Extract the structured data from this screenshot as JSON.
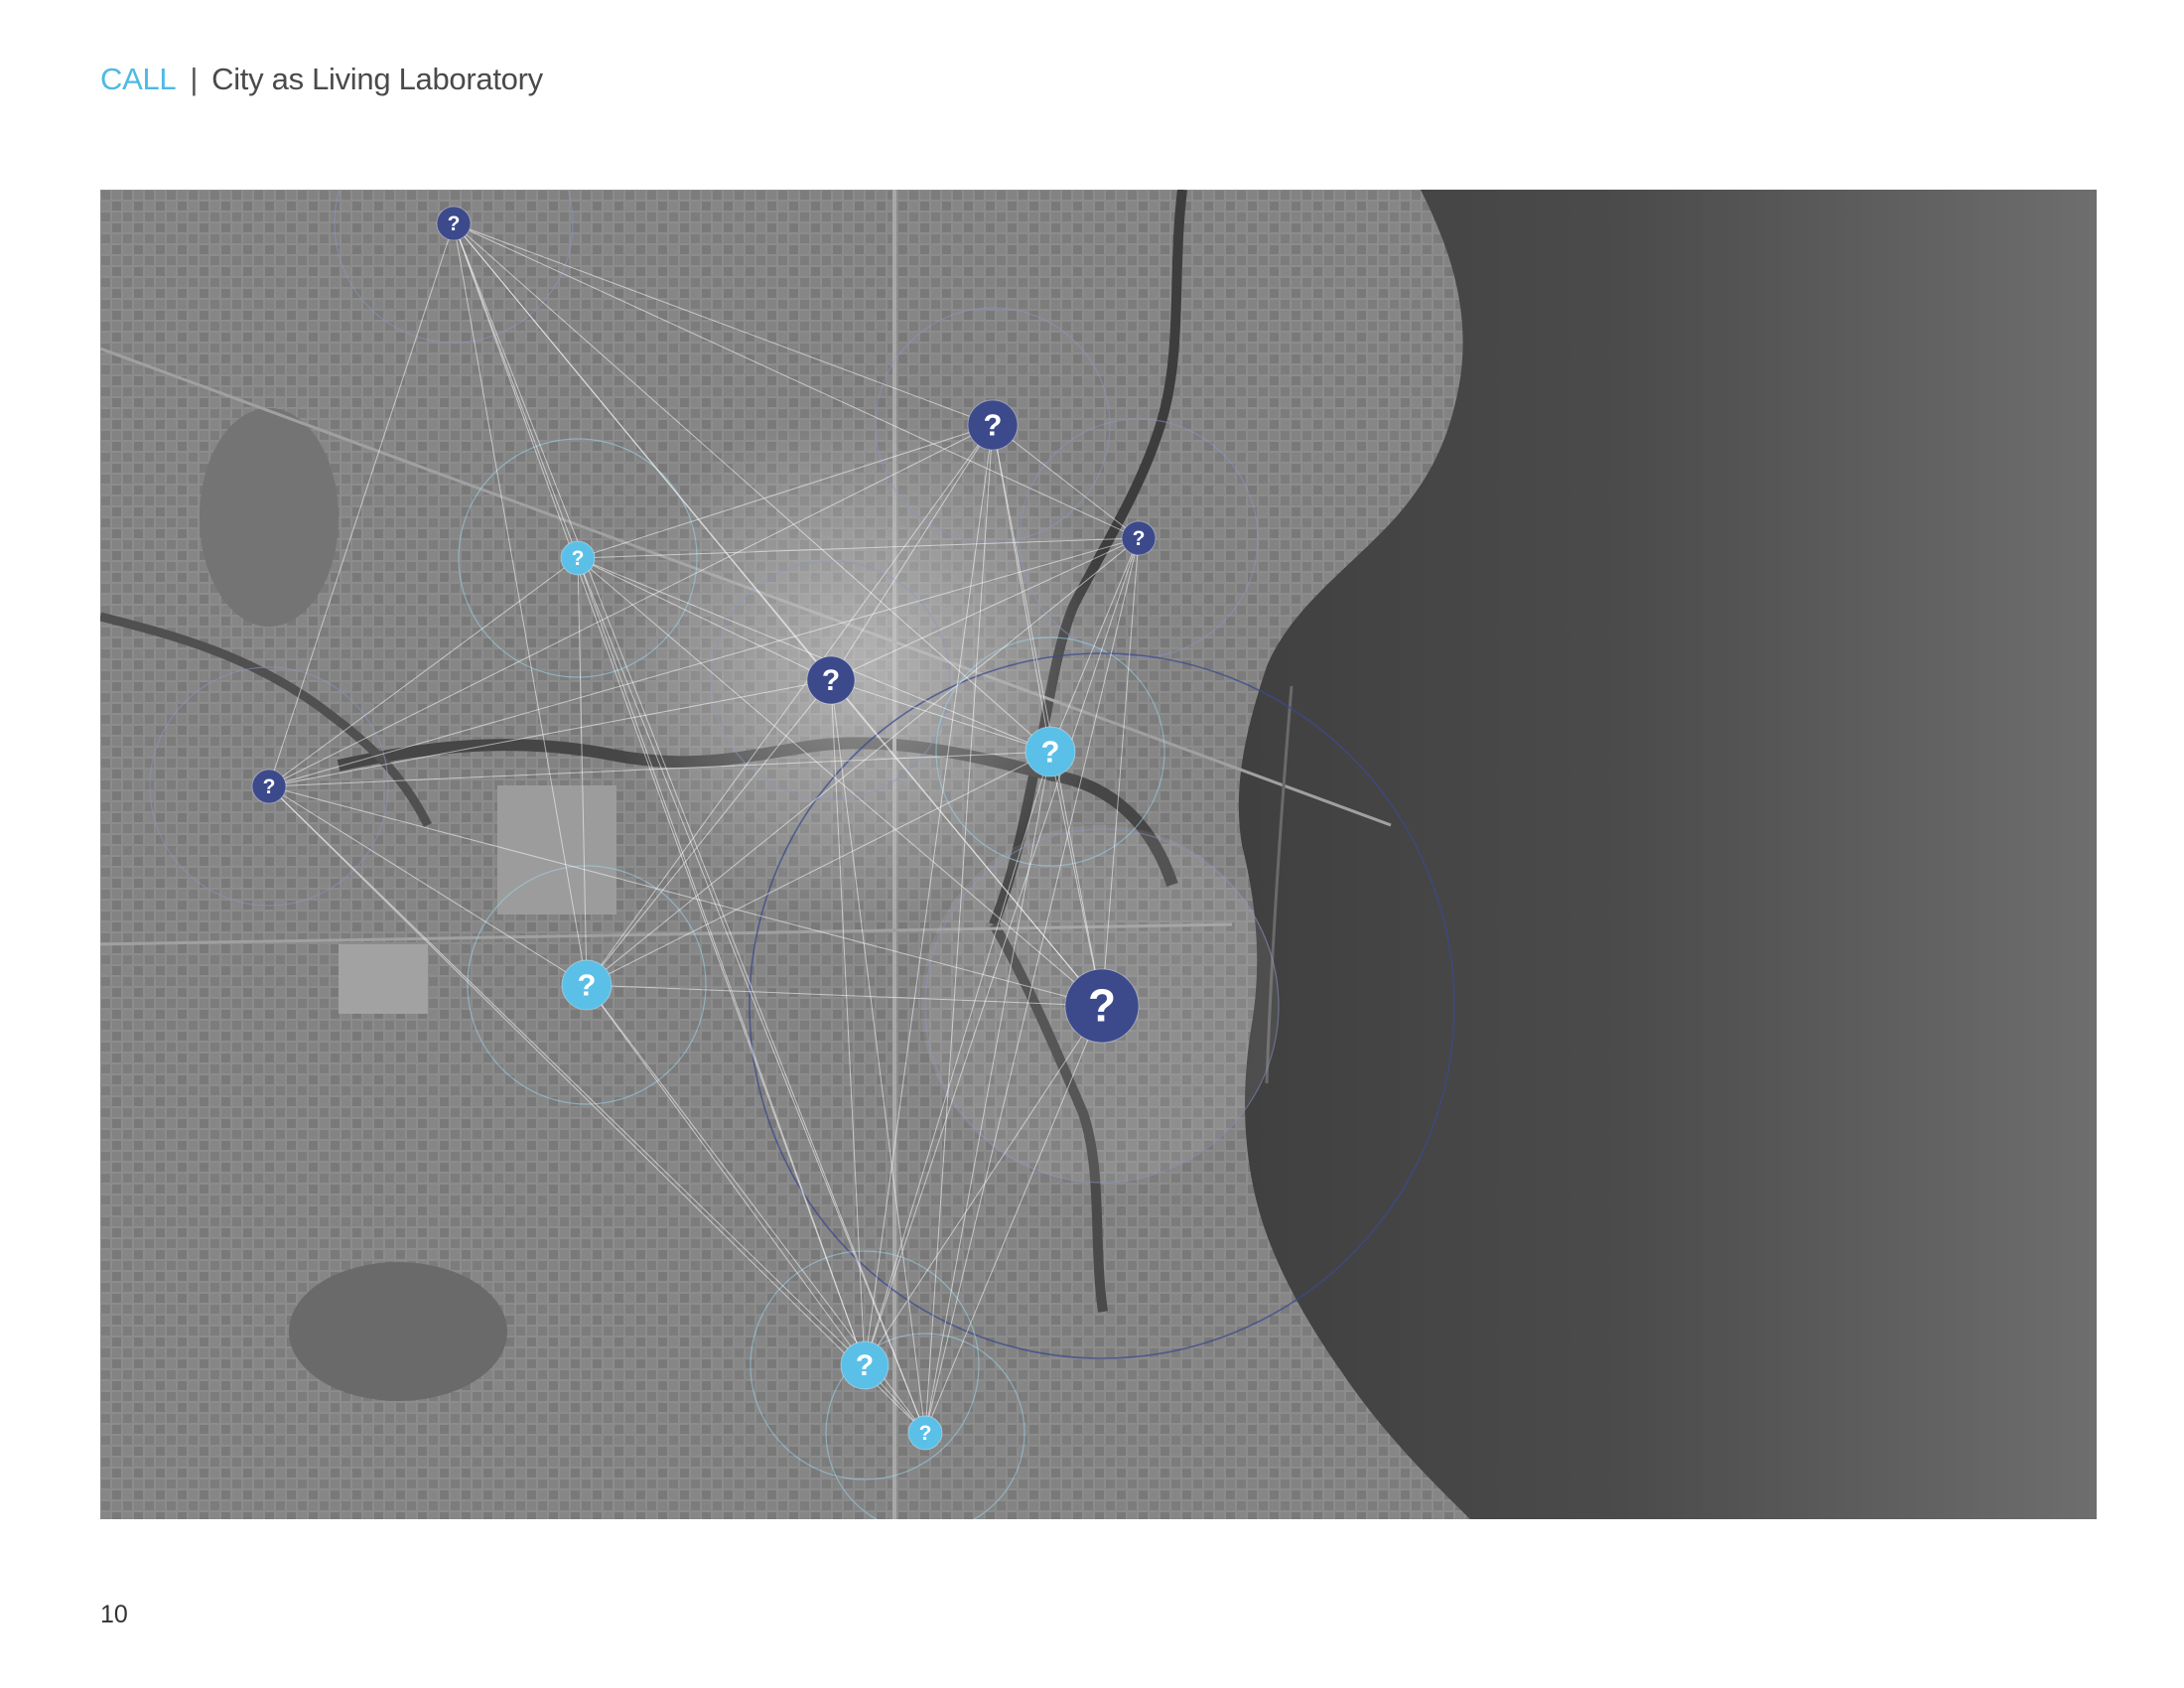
{
  "header": {
    "brand": "CALL",
    "separator": "|",
    "title": "City as Living Laboratory"
  },
  "footer": {
    "page_number": "10"
  },
  "map": {
    "marker_glyph": "?",
    "colors": {
      "dark_marker": "#3c4a8c",
      "light_marker": "#5bc0e8",
      "land_base": "#8a8a8a",
      "water_base": "#4a4a4a",
      "connection_line": "#ffffff"
    }
  }
}
